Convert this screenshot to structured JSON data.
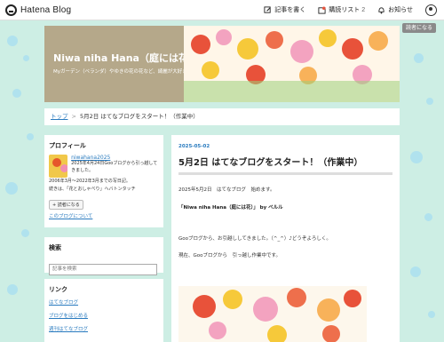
{
  "topbar": {
    "logo_text": "Hatena Blog",
    "write_label": "記事を書く",
    "readlist_label": "購読リスト",
    "readlist_count": "2",
    "notify_label": "お知らせ"
  },
  "reader_button": "読者になる",
  "header": {
    "title": "Niwa niha Hana（庭には花）",
    "description": "Myガーデン（ベランダ）やゆきの花の花など、綺麗が大好き！"
  },
  "breadcrumb": {
    "top": "トップ",
    "separator": ">",
    "current": "5月2日 はてなブログをスタート！（作業中）"
  },
  "sidebar": {
    "profile": {
      "heading": "プロフィール",
      "name": "niwahana2025",
      "desc1": "2025年4月24日Gooブログから引っ越してきました。",
      "desc2": "2006年3月〜2022年3月までの写日記。",
      "desc3": "続きは、「花とおしゃべり」へバトンタッチ",
      "reader_button": "読者になる",
      "about_link": "このブログについて"
    },
    "search": {
      "heading": "検索",
      "placeholder": "記事を検索"
    },
    "links": {
      "heading": "リンク",
      "items": [
        "はてなブログ",
        "ブログをはじめる",
        "週刊はてなブログ"
      ]
    }
  },
  "article": {
    "date": "2025-05-02",
    "title": "5月2日 はてなブログをスタート！（作業中）",
    "p1": "2025年5月2日　はてなブログ　始めます。",
    "p2": "「Niwa niha Hana（庭には花）」 by ベルル",
    "p3": "Gooブログから、お引越ししてきました。（^_^）♪どうぞよろしく。",
    "p4": "現在、Gooブログから　引っ越し作業中です。"
  },
  "colors": {
    "background": "#cdeee4",
    "link": "#2a7bbf",
    "header_bg": "#b5a88a"
  }
}
